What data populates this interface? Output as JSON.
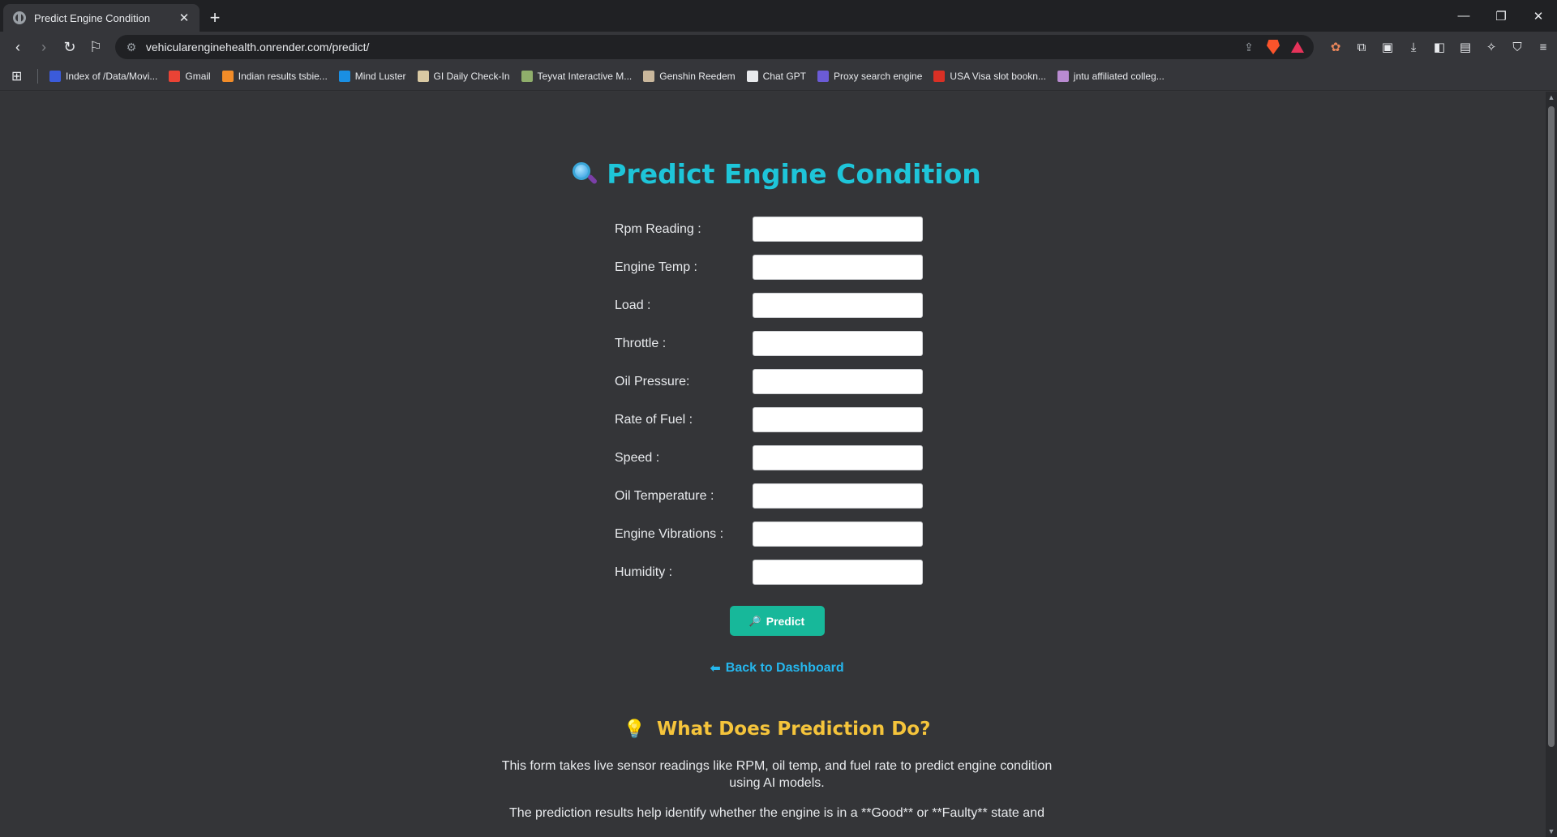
{
  "browser": {
    "tab_title": "Predict Engine Condition",
    "url": "vehicularenginehealth.onrender.com/predict/",
    "bookmarks": [
      {
        "label": "Index of /Data/Movi...",
        "color": "#3b5bdb"
      },
      {
        "label": "Gmail",
        "color": "#ea4335"
      },
      {
        "label": "Indian results tsbie...",
        "color": "#f28c28"
      },
      {
        "label": "Mind Luster",
        "color": "#1a8fe3"
      },
      {
        "label": "GI Daily Check-In",
        "color": "#d9c9a3"
      },
      {
        "label": "Teyvat Interactive M...",
        "color": "#8fae6b"
      },
      {
        "label": "Genshin Reedem",
        "color": "#c9b79c"
      },
      {
        "label": "Chat GPT",
        "color": "#e8eaed"
      },
      {
        "label": "Proxy search engine",
        "color": "#6b5bd6"
      },
      {
        "label": "USA Visa slot bookn...",
        "color": "#d93025"
      },
      {
        "label": "jntu affiliated colleg...",
        "color": "#b98bd1"
      }
    ]
  },
  "page": {
    "title": "Predict Engine Condition",
    "fields": [
      {
        "label": "Rpm Reading :",
        "value": ""
      },
      {
        "label": "Engine Temp :",
        "value": ""
      },
      {
        "label": "Load :",
        "value": ""
      },
      {
        "label": "Throttle :",
        "value": ""
      },
      {
        "label": "Oil Pressure:",
        "value": ""
      },
      {
        "label": "Rate of Fuel :",
        "value": ""
      },
      {
        "label": "Speed :",
        "value": ""
      },
      {
        "label": "Oil Temperature :",
        "value": ""
      },
      {
        "label": "Engine Vibrations :",
        "value": ""
      },
      {
        "label": "Humidity :",
        "value": ""
      }
    ],
    "predict_label": "Predict",
    "back_link": "Back to Dashboard",
    "info_title": "What Does Prediction Do?",
    "info_p1": "This form takes live sensor readings like RPM, oil temp, and fuel rate to predict engine condition using AI models.",
    "info_p2": "The prediction results help identify whether the engine is in a **Good** or **Faulty** state and",
    "colors": {
      "title": "#1ec5d9",
      "button": "#17b89a",
      "link": "#25b7ee",
      "info_title": "#f5c43b"
    }
  }
}
